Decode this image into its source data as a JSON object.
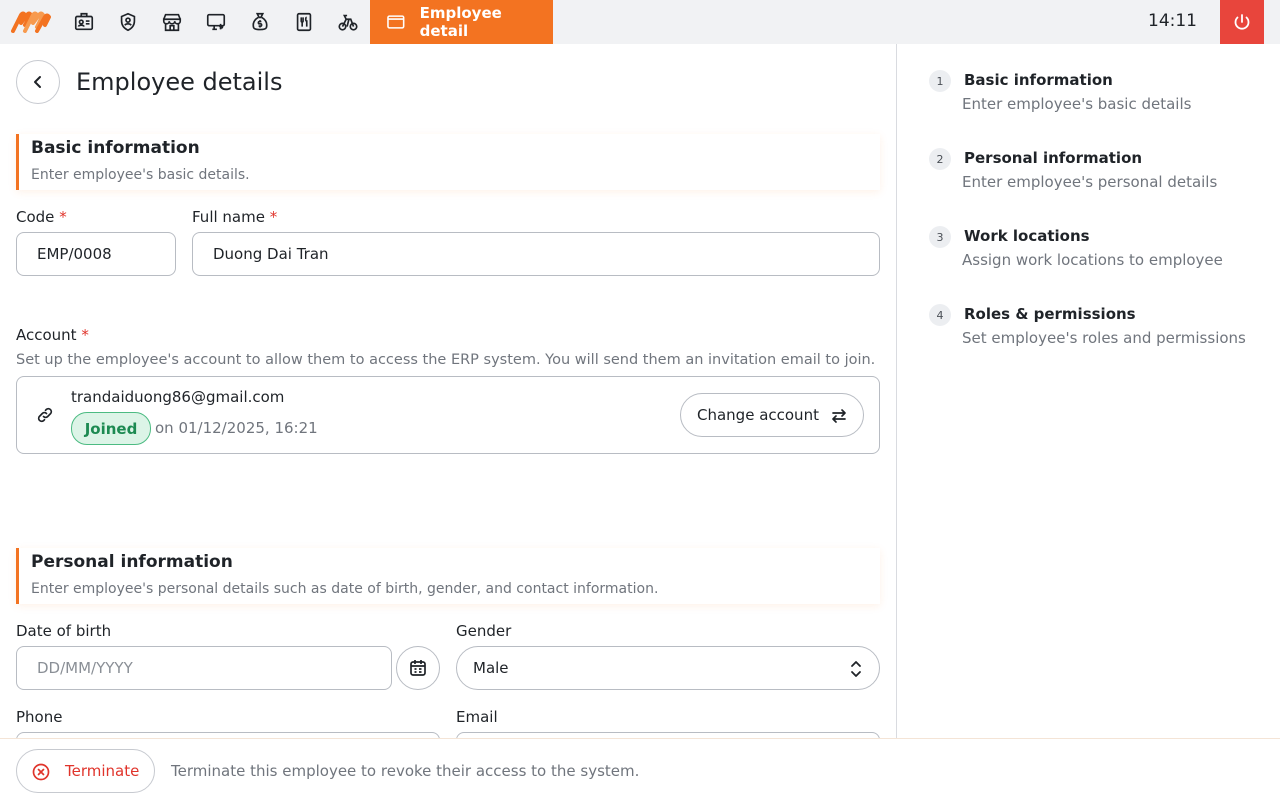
{
  "topbar": {
    "active_tab": "Employee detail",
    "clock": "14:11",
    "nav_icons": [
      "employee-card-icon",
      "shield-icon",
      "store-icon",
      "pos-terminal-icon",
      "money-bag-icon",
      "menu-icon",
      "cycle-icon"
    ]
  },
  "page": {
    "title": "Employee details"
  },
  "basic": {
    "title": "Basic information",
    "subtitle": "Enter employee's basic details.",
    "code_label": "Code",
    "code_value": "EMP/0008",
    "fullname_label": "Full name",
    "fullname_value": "Duong Dai Tran",
    "required_mark": "*"
  },
  "account": {
    "label": "Account",
    "help": "Set up the employee's account to allow them to access the ERP system. You will send them an invitation email to join.",
    "email": "trandaiduong86@gmail.com",
    "status": "Joined",
    "joined_on": "on 01/12/2025, 16:21",
    "change_label": "Change account"
  },
  "personal": {
    "title": "Personal information",
    "subtitle": "Enter employee's personal details such as date of birth, gender, and contact information.",
    "dob_label": "Date of birth",
    "dob_placeholder": "DD/MM/YYYY",
    "gender_label": "Gender",
    "gender_value": "Male",
    "phone_label": "Phone",
    "email_label": "Email"
  },
  "footer": {
    "terminate_label": "Terminate",
    "terminate_desc": "Terminate this employee to revoke their access to the system."
  },
  "steps": [
    {
      "num": "1",
      "title": "Basic information",
      "subtitle": "Enter employee's basic details"
    },
    {
      "num": "2",
      "title": "Personal information",
      "subtitle": "Enter employee's personal details"
    },
    {
      "num": "3",
      "title": "Work locations",
      "subtitle": "Assign work locations to employee"
    },
    {
      "num": "4",
      "title": "Roles & permissions",
      "subtitle": "Set employee's roles and permissions"
    }
  ],
  "colors": {
    "accent": "#f37321",
    "danger": "#e8453c",
    "success": "#1d8a52"
  }
}
